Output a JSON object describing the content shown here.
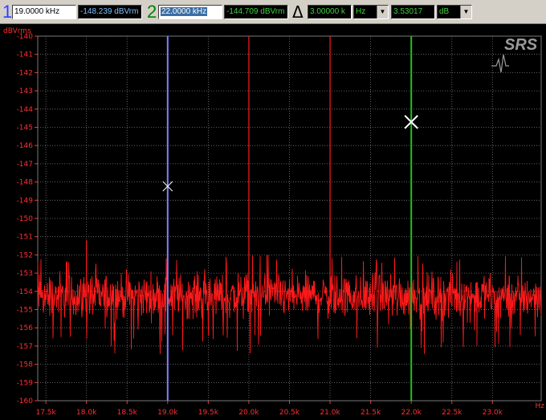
{
  "colors": {
    "trace": "#ff1a1a",
    "label": "#ff3030",
    "grid": "#7a7a7a",
    "marker1": "#8080ff",
    "marker2": "#22c022",
    "marker1_text": "#3040ff",
    "marker2_text": "#008000",
    "value_text": "#80c0ff",
    "value2_text": "#40d040"
  },
  "toolbar": {
    "marker1": {
      "index": "1",
      "freq": "19.0000 kHz",
      "level": "-148.239 dBVrm"
    },
    "marker2": {
      "index": "2",
      "freq": "22.0000 kHz",
      "level": "-144.709 dBVrm"
    },
    "delta": {
      "symbol": "Δ",
      "freq": "3.00000 k",
      "freq_unit": "Hz",
      "level": "3.53017",
      "level_unit": "dB"
    }
  },
  "logo": "SRS",
  "chart_data": {
    "type": "line",
    "ylabel": "dBVrms",
    "xlabel": "Hz",
    "ylim": [
      -160,
      -140
    ],
    "xlim": [
      17400,
      23600
    ],
    "yticks": [
      "-140",
      "-141",
      "-142",
      "-143",
      "-144",
      "-145",
      "-146",
      "-147",
      "-148",
      "-149",
      "-150",
      "-151",
      "-152",
      "-153",
      "-154",
      "-155",
      "-156",
      "-157",
      "-158",
      "-159",
      "-160"
    ],
    "xticks": [
      "17.5k",
      "18.0k",
      "18.5k",
      "19.0k",
      "19.5k",
      "20.0k",
      "20.5k",
      "21.0k",
      "21.5k",
      "22.0k",
      "22.5k",
      "23.0k"
    ],
    "grid": true,
    "noise_floor": {
      "mean": -154.3,
      "typical_range": [
        -156,
        -152.5
      ],
      "min": -157.5,
      "max": -152
    },
    "peaks": [
      {
        "x": 18000,
        "y": -151.2
      },
      {
        "x": 19000,
        "y": -140
      },
      {
        "x": 20000,
        "y": -140
      },
      {
        "x": 21000,
        "y": -140
      },
      {
        "x": 22000,
        "y": -140
      }
    ],
    "markers": [
      {
        "name": "1",
        "x": 19000,
        "y": -148.239
      },
      {
        "name": "2",
        "x": 22000,
        "y": -144.709
      }
    ]
  }
}
